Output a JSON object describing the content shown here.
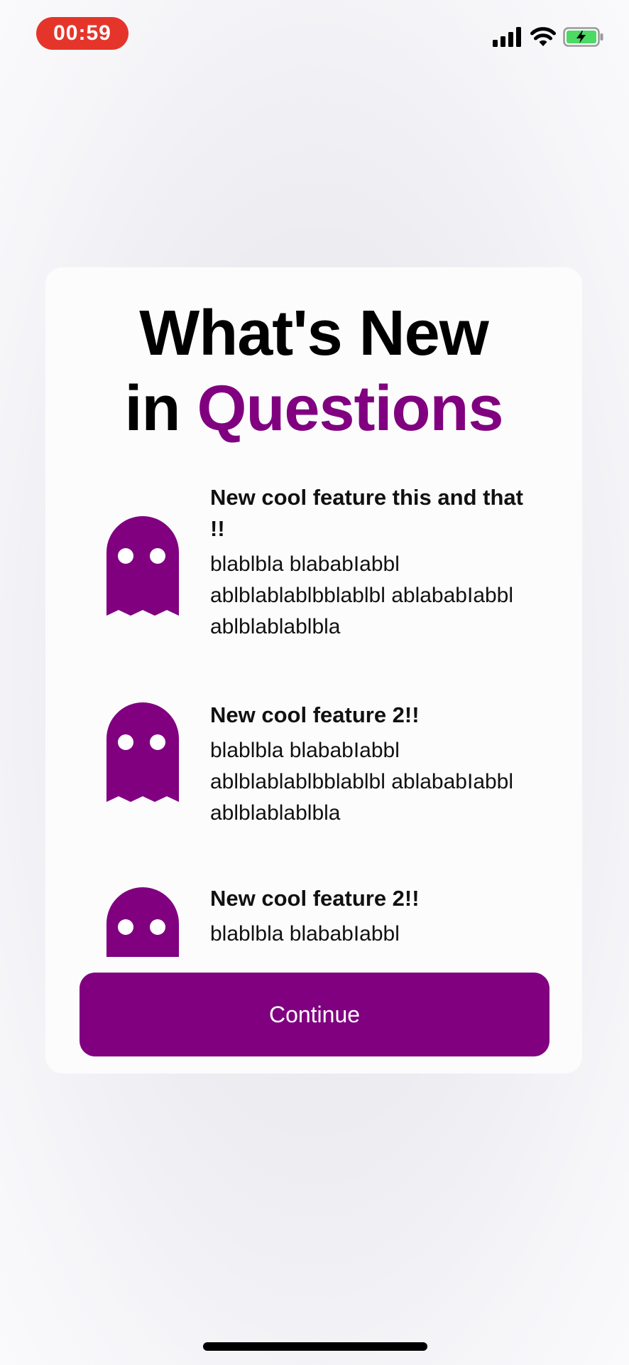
{
  "status_bar": {
    "time": "00:59",
    "icons": [
      "cellular-signal-icon",
      "wifi-icon",
      "battery-charging-icon"
    ],
    "time_pill_color": "#e5352b",
    "battery_color": "#4cd964"
  },
  "card": {
    "title_line1": "What's New",
    "title_line2_prefix": "in",
    "title_line2_accent": "Questions",
    "accent_color": "#800080",
    "features": [
      {
        "icon": "ghost-icon",
        "title": "New cool feature this and that !!",
        "description": "blablbla blababIabbl ablblablablbblablbl ablababIabbl ablblablablbla"
      },
      {
        "icon": "ghost-icon",
        "title": "New cool feature 2!!",
        "description": "blablbla blababIabbl ablblablablbblablbl ablababIabbl ablblablablbla"
      },
      {
        "icon": "ghost-icon",
        "title": "New cool feature 2!!",
        "description": "blablbla blababIabbl"
      }
    ],
    "continue_label": "Continue"
  }
}
